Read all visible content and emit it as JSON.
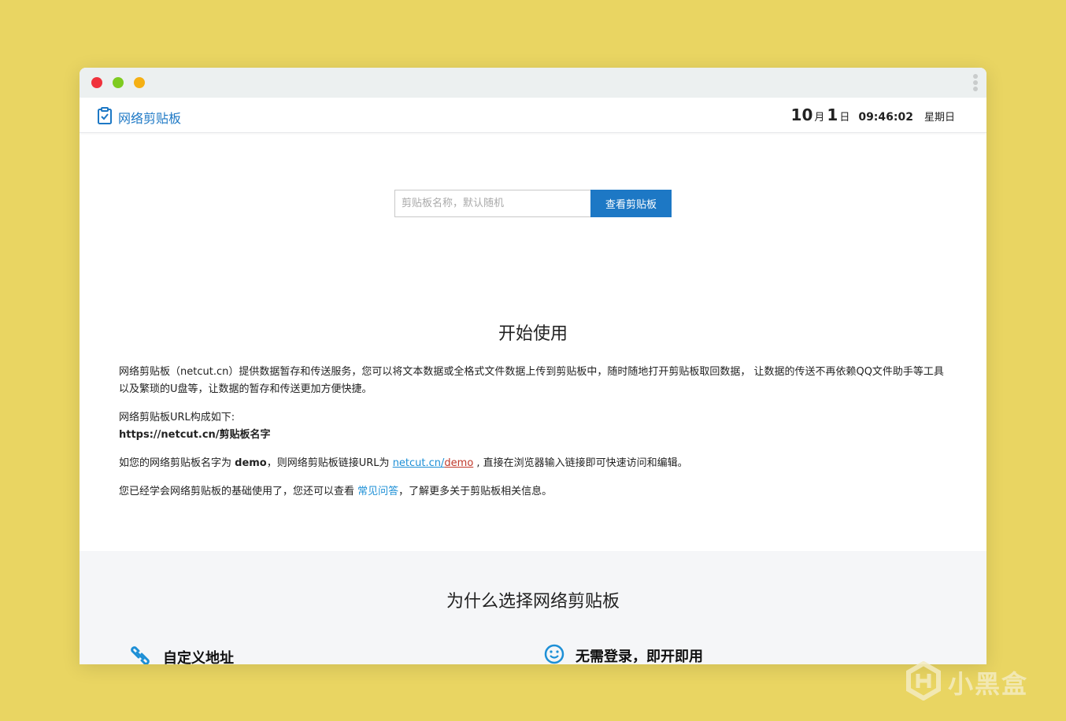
{
  "brand": {
    "name": "网络剪贴板",
    "icon": "clipboard-check-icon",
    "color": "#1d78c5"
  },
  "clock": {
    "month": "10",
    "month_unit": "月",
    "day": "1",
    "day_unit": "日",
    "time": "09:46:02",
    "weekday": "星期日"
  },
  "search": {
    "placeholder": "剪贴板名称，默认随机",
    "button_label": "查看剪贴板"
  },
  "intro": {
    "title": "开始使用",
    "p1": "网络剪贴板（netcut.cn）提供数据暂存和传送服务，您可以将文本数据或全格式文件数据上传到剪贴板中，随时随地打开剪贴板取回数据， 让数据的传送不再依赖QQ文件助手等工具以及繁琐的U盘等，让数据的暂存和传送更加方便快捷。",
    "p2_line1": "网络剪贴板URL构成如下:",
    "p2_line2": "https://netcut.cn/剪贴板名字",
    "p3_a": "如您的网络剪贴板名字为 ",
    "p3_b": "demo",
    "p3_c": "，则网络剪贴板链接URL为 ",
    "p3_link1": "netcut.cn/",
    "p3_link2": "demo",
    "p3_d": " , 直接在浏览器输入链接即可快速访问和编辑。",
    "p4_a": "您已经学会网络剪贴板的基础使用了，您还可以查看 ",
    "p4_link": "常见问答",
    "p4_b": "，了解更多关于剪贴板相关信息。"
  },
  "why": {
    "title": "为什么选择网络剪贴板",
    "features": [
      {
        "icon": "link-icon",
        "title": "自定义地址"
      },
      {
        "icon": "smile-icon",
        "title": "无需登录，即开即用"
      }
    ]
  },
  "watermark": {
    "text": "小黑盒",
    "icon": "heybox-logo-icon"
  },
  "colors": {
    "background": "#e9d562",
    "accent": "#1d78c5",
    "link": "#1d8fd6"
  }
}
